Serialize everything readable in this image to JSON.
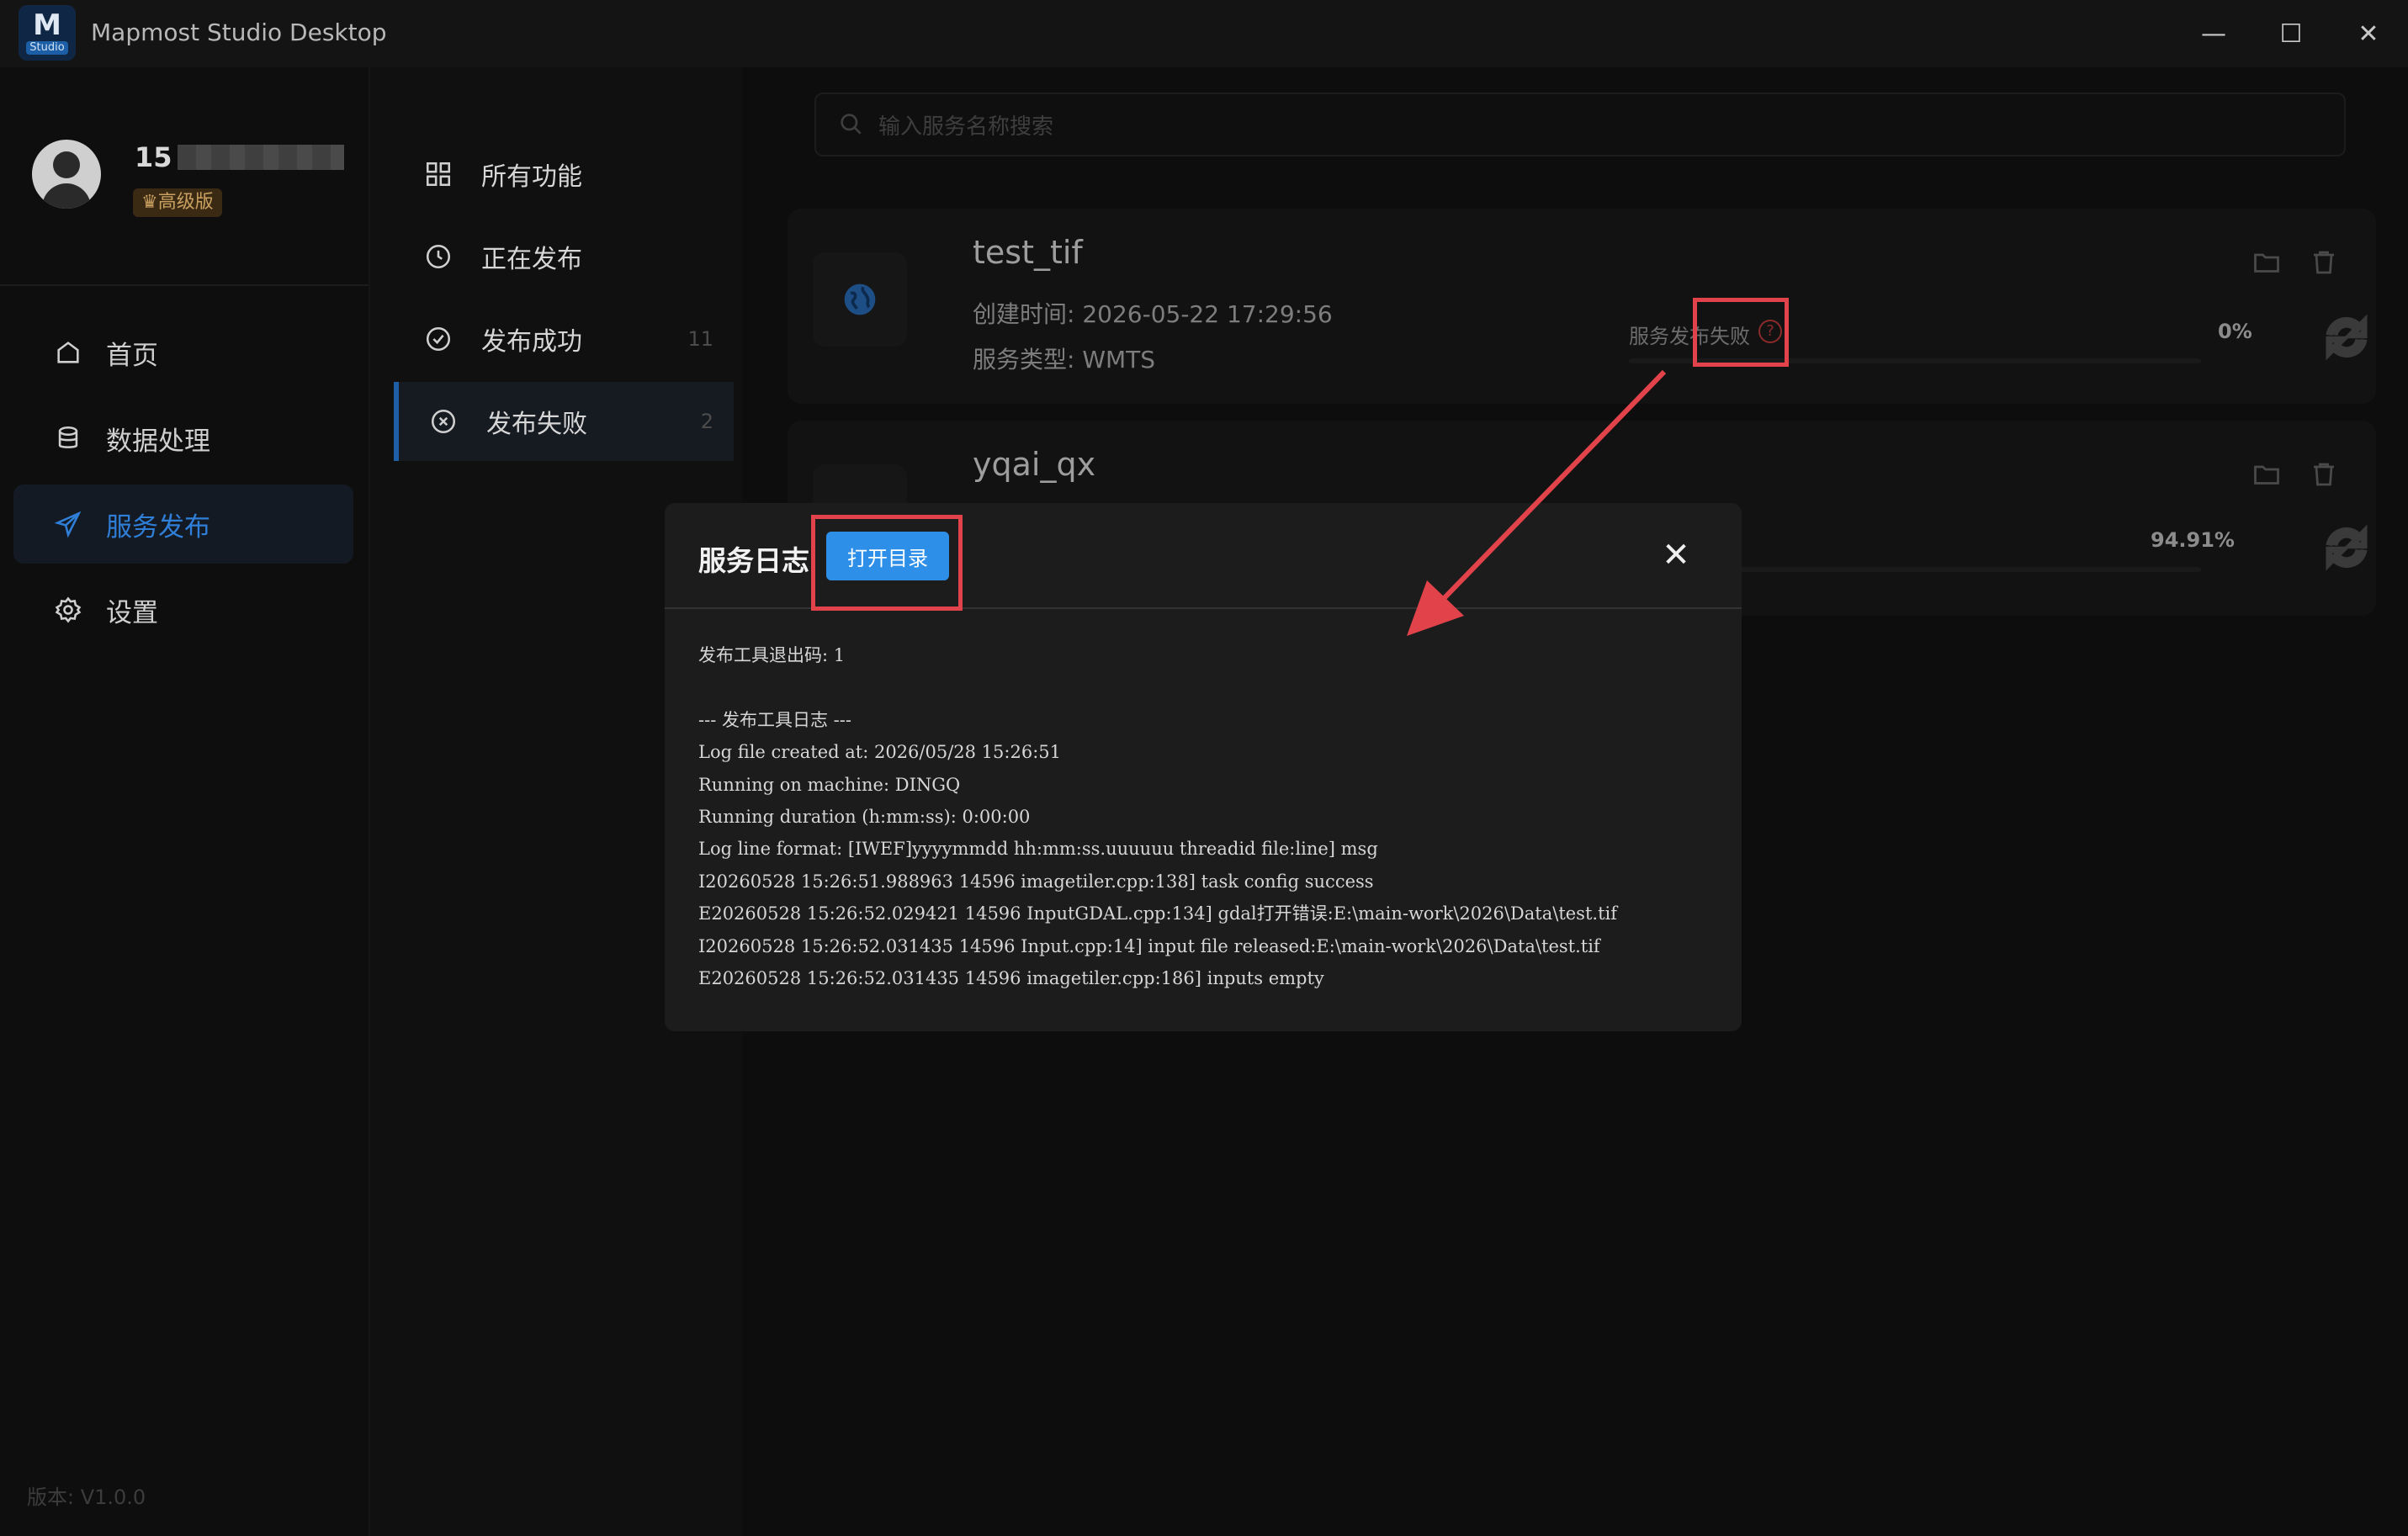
{
  "window": {
    "title": "Mapmost Studio Desktop",
    "logo_letter": "M",
    "logo_tag": "Studio",
    "controls": {
      "minimize": "—",
      "maximize": "☐",
      "close": "✕"
    }
  },
  "user": {
    "id_visible": "15",
    "badge": "高级版",
    "badge_icon": "crown-icon"
  },
  "sidebar": {
    "items": [
      {
        "label": "首页",
        "icon": "home-icon",
        "active": false
      },
      {
        "label": "数据处理",
        "icon": "database-icon",
        "active": false
      },
      {
        "label": "服务发布",
        "icon": "send-icon",
        "active": true
      },
      {
        "label": "设置",
        "icon": "gear-icon",
        "active": false
      }
    ],
    "version": "版本: V1.0.0"
  },
  "subnav": {
    "items": [
      {
        "label": "所有功能",
        "icon": "grid-icon",
        "count": ""
      },
      {
        "label": "正在发布",
        "icon": "clock-icon",
        "count": ""
      },
      {
        "label": "发布成功",
        "icon": "check-circle-icon",
        "count": "11"
      },
      {
        "label": "发布失败",
        "icon": "x-circle-icon",
        "count": "2",
        "active": true
      }
    ]
  },
  "search": {
    "placeholder": "输入服务名称搜索"
  },
  "services": [
    {
      "name": "test_tif",
      "created": "创建时间: 2026-05-22 17:29:56",
      "type": "服务类型: WMTS",
      "status": "服务发布失败",
      "percent": "0%",
      "progress": 0
    },
    {
      "name": "yqai_qx",
      "percent": "94.91%",
      "progress": 0.9491
    }
  ],
  "modal": {
    "title": "服务日志",
    "open_button": "打开目录",
    "close": "✕",
    "log_lines": [
      "发布工具退出码: 1",
      "",
      "--- 发布工具日志 ---",
      "Log file created at: 2026/05/28 15:26:51",
      "Running on machine: DINGQ",
      "Running duration (h:mm:ss): 0:00:00",
      "Log line format: [IWEF]yyyymmdd hh:mm:ss.uuuuuu threadid file:line] msg",
      "I20260528 15:26:51.988963 14596 imagetiler.cpp:138] task config success",
      "E20260528 15:26:52.029421 14596 InputGDAL.cpp:134] gdal打开错误:E:\\main-work\\2026\\Data\\test.tif",
      "I20260528 15:26:52.031435 14596 Input.cpp:14] input file released:E:\\main-work\\2026\\Data\\test.tif",
      "E20260528 15:26:52.031435 14596 imagetiler.cpp:186] inputs empty"
    ]
  },
  "colors": {
    "accent": "#2d8fe8",
    "active_nav": "#2f7fd8",
    "annotation": "#e2434a",
    "error": "#8b2a2a"
  }
}
